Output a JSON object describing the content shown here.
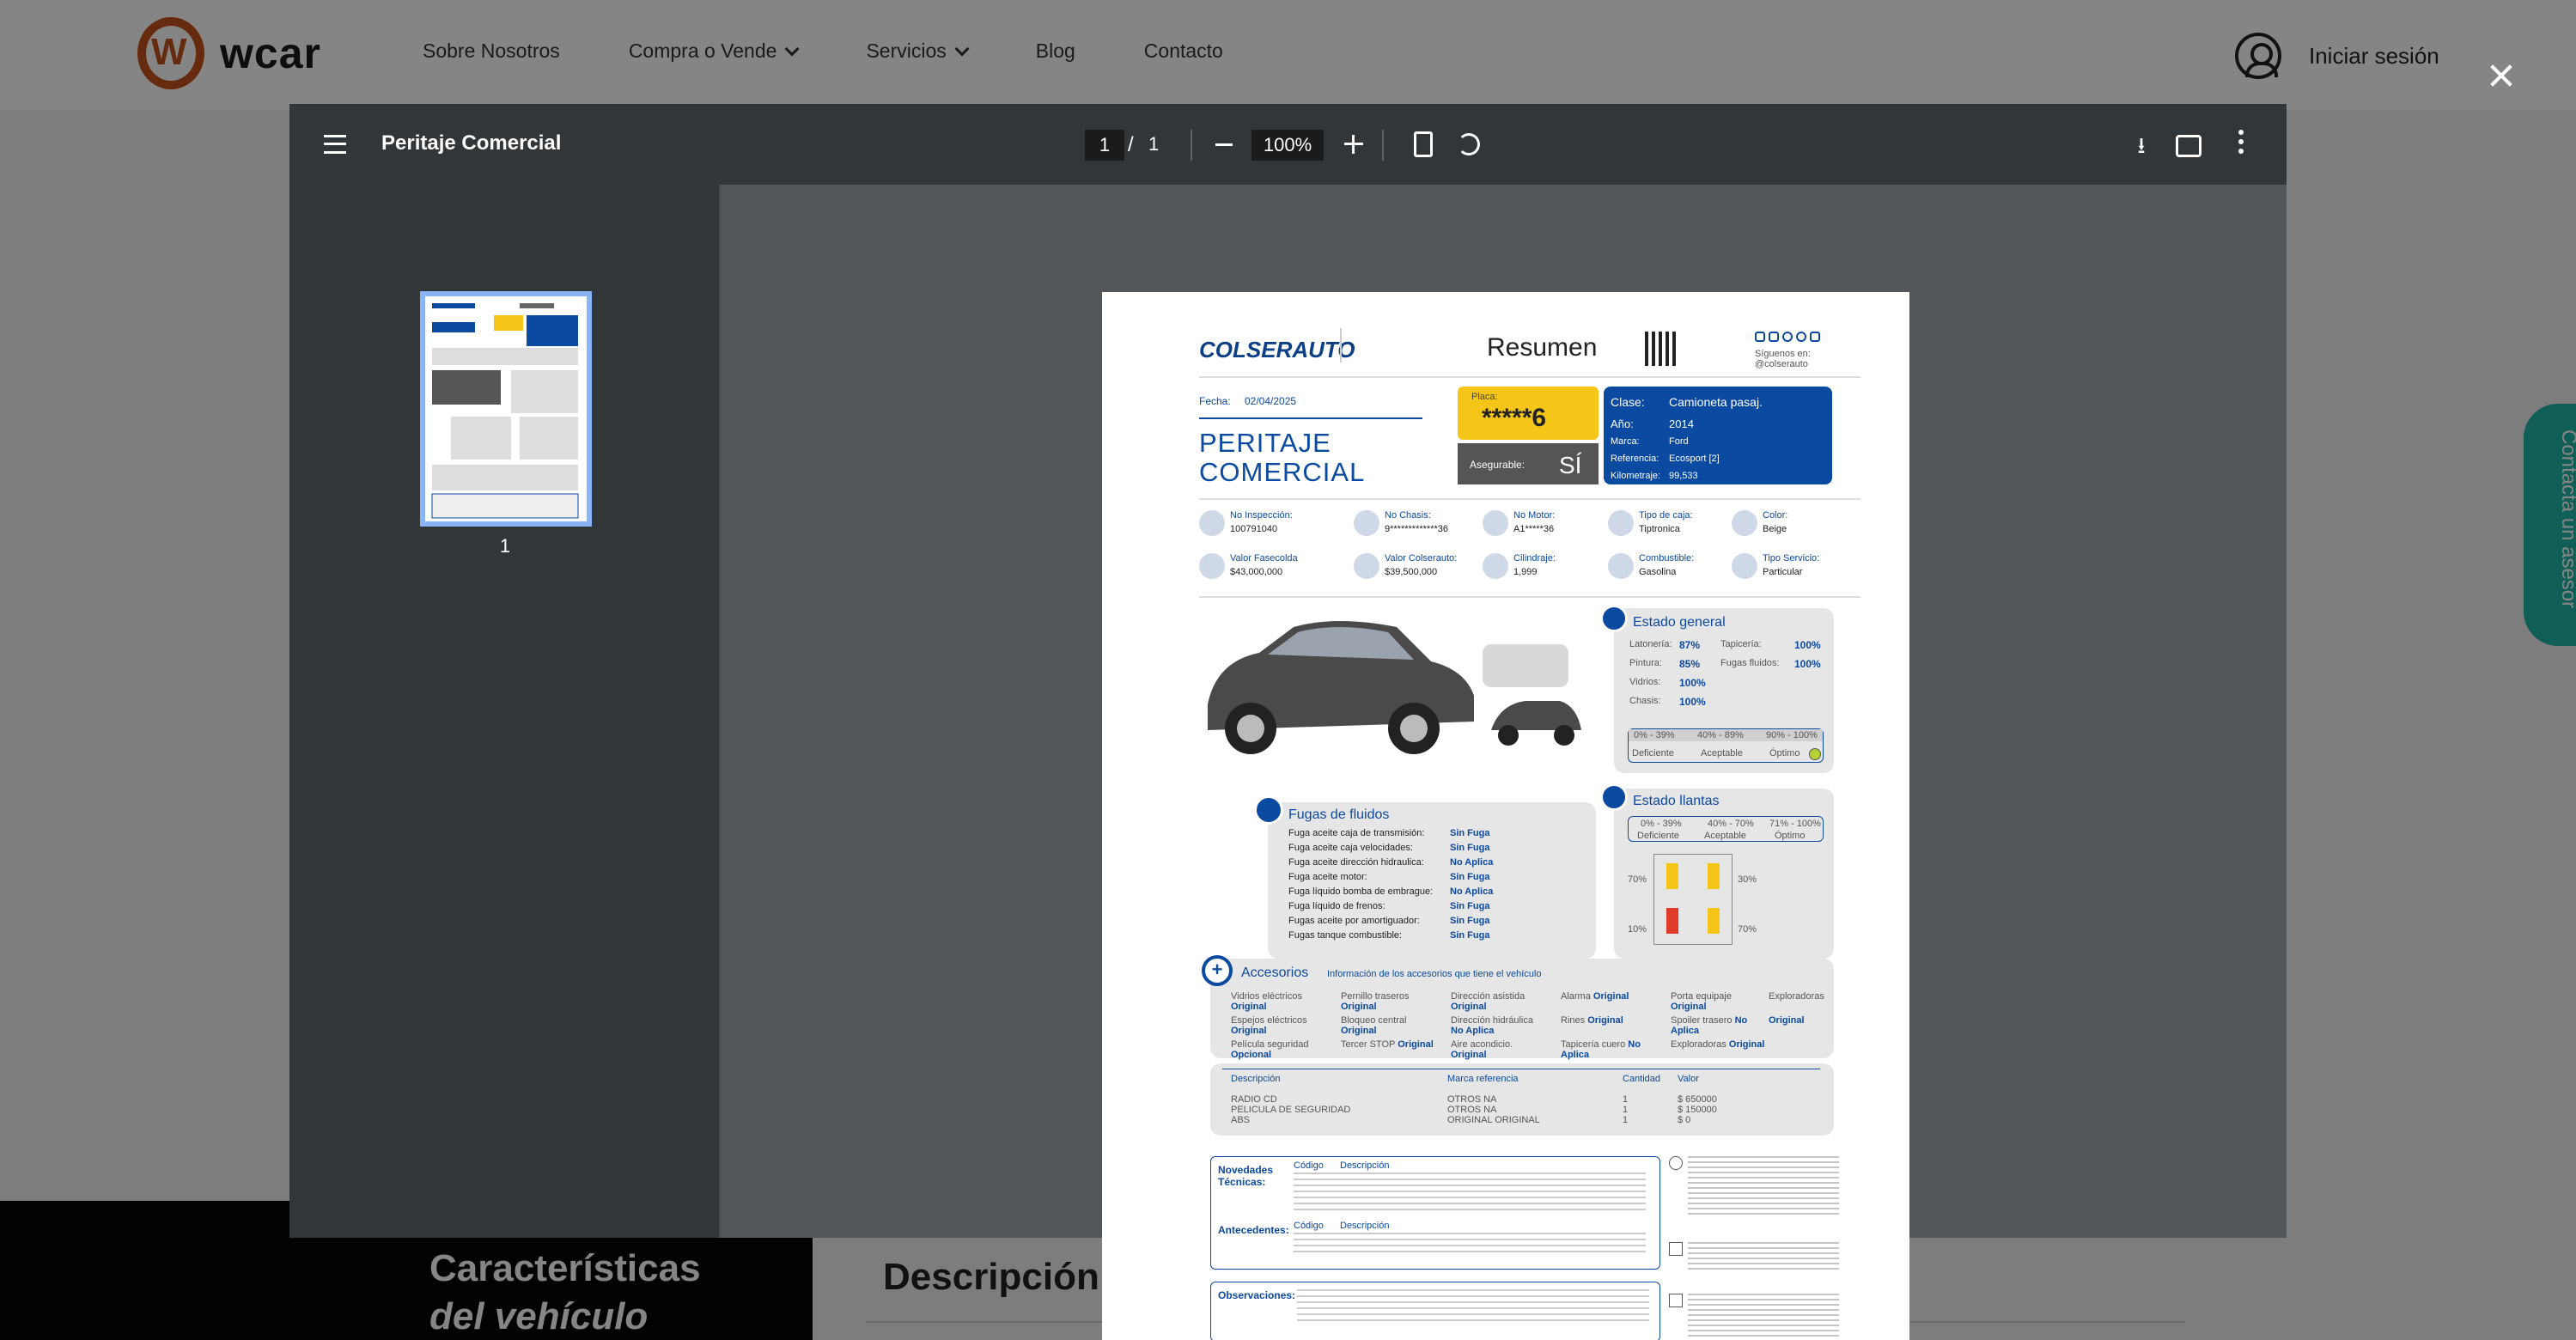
{
  "site": {
    "logo_text": "wcar",
    "nav": [
      "Sobre Nosotros",
      "Compra o Vende",
      "Servicios",
      "Blog",
      "Contacto"
    ],
    "login_label": "Iniciar sesión",
    "char_title_line1": "Características",
    "char_title_line2": "del vehículo",
    "desc_title": "Descripción",
    "side_tab": "Contacta un asesor"
  },
  "viewer": {
    "title": "Peritaje Comercial",
    "page_current": "1",
    "page_sep": "/",
    "page_total": "1",
    "zoom": "100%",
    "thumb_label": "1"
  },
  "report": {
    "brand": "COLSERAUTO",
    "summary": "Resumen",
    "follow": "Síguenos en: @colserauto",
    "date_label": "Fecha:",
    "date": "02/04/2025",
    "title_line1": "PERITAJE",
    "title_line2": "COMERCIAL",
    "plate_label": "Placa:",
    "plate": "*****6",
    "insurable_label": "Asegurable:",
    "insurable": "SÍ",
    "specs": [
      {
        "label": "Clase:",
        "value": "Camioneta pasaj."
      },
      {
        "label": "Año:",
        "value": "2014"
      },
      {
        "label": "Marca:",
        "value": "Ford"
      },
      {
        "label": "Referencia:",
        "value": "Ecosport [2]"
      },
      {
        "label": "Kilometraje:",
        "value": "99,533"
      }
    ],
    "info": [
      {
        "label": "No Inspección:",
        "value": "100791040"
      },
      {
        "label": "No Chasis:",
        "value": "9*************36"
      },
      {
        "label": "No Motor:",
        "value": "A1*****36"
      },
      {
        "label": "Tipo de caja:",
        "value": "Tiptronica"
      },
      {
        "label": "Color:",
        "value": "Beige"
      },
      {
        "label": "Valor Fasecolda",
        "value": "$43,000,000"
      },
      {
        "label": "Valor Colserauto:",
        "value": "$39,500,000"
      },
      {
        "label": "Cilindraje:",
        "value": "1,999"
      },
      {
        "label": "Combustible:",
        "value": "Gasolina"
      },
      {
        "label": "Tipo Servicio:",
        "value": "Particular"
      }
    ],
    "general_title": "Estado general",
    "general": [
      {
        "label": "Latonería:",
        "value": "87%"
      },
      {
        "label": "Tapicería:",
        "value": "100%"
      },
      {
        "label": "Pintura:",
        "value": "85%"
      },
      {
        "label": "Fugas fluidos:",
        "value": "100%"
      },
      {
        "label": "Vidrios:",
        "value": "100%"
      },
      {
        "label": "Chasis:",
        "value": "100%"
      }
    ],
    "scale_ranges": [
      "0% - 39%",
      "40% - 89%",
      "90% - 100%"
    ],
    "scale_labels": [
      "Deficiente",
      "Aceptable",
      "Óptimo"
    ],
    "tires_title": "Estado llantas",
    "tire_ranges": [
      "0% - 39%",
      "40% - 70%",
      "71% - 100%"
    ],
    "tire_values": [
      "70%",
      "30%",
      "10%",
      "70%"
    ],
    "leaks_title": "Fugas de fluidos",
    "leaks": [
      {
        "label": "Fuga aceite caja de transmisión:",
        "value": "Sin Fuga"
      },
      {
        "label": "Fuga aceite caja velocidades:",
        "value": "Sin Fuga"
      },
      {
        "label": "Fuga aceite dirección hidraulica:",
        "value": "No Aplica"
      },
      {
        "label": "Fuga aceite motor:",
        "value": "Sin Fuga"
      },
      {
        "label": "Fuga líquido bomba de embrague:",
        "value": "No Aplica"
      },
      {
        "label": "Fuga líquido de frenos:",
        "value": "Sin Fuga"
      },
      {
        "label": "Fugas aceite por amortiguador:",
        "value": "Sin Fuga"
      },
      {
        "label": "Fugas tanque combustible:",
        "value": "Sin Fuga"
      }
    ],
    "acc_title": "Accesorios",
    "acc_subtitle": "Información de los accesorios que tiene el vehículo",
    "accessories": [
      {
        "label": "Vidrios eléctricos",
        "value": "Original"
      },
      {
        "label": "Pernillo traseros",
        "value": "Original"
      },
      {
        "label": "Dirección asistida",
        "value": "Original"
      },
      {
        "label": "Alarma",
        "value": "Original"
      },
      {
        "label": "Porta equipaje",
        "value": "Original"
      },
      {
        "label": "Exploradoras",
        "value": ""
      },
      {
        "label": "Espejos eléctricos",
        "value": "Original"
      },
      {
        "label": "Bloqueo central",
        "value": "Original"
      },
      {
        "label": "Dirección hidráulica",
        "value": "No Aplica"
      },
      {
        "label": "Rines",
        "value": "Original"
      },
      {
        "label": "Spoiler trasero",
        "value": "No Aplica"
      },
      {
        "label": "",
        "value": "Original"
      },
      {
        "label": "Película seguridad",
        "value": "Opcional"
      },
      {
        "label": "Tercer STOP",
        "value": "Original"
      },
      {
        "label": "Aire acondicio.",
        "value": "Original"
      },
      {
        "label": "Tapicería cuero",
        "value": "No Aplica"
      },
      {
        "label": "Exploradoras",
        "value": "Original"
      }
    ],
    "table_headers": [
      "Descripción",
      "Marca referencia",
      "Cantidad",
      "Valor"
    ],
    "table_rows": [
      [
        "RADIO CD",
        "OTROS NA",
        "1",
        "$ 650000"
      ],
      [
        "PELICULA DE SEGURIDAD",
        "OTROS NA",
        "1",
        "$ 150000"
      ],
      [
        "ABS",
        "ORIGINAL ORIGINAL",
        "1",
        "$ 0"
      ]
    ],
    "novedades_title": "Novedades Técnicas:",
    "antecedentes_title": "Antecedentes:",
    "observaciones_title": "Observaciones:",
    "code_header": "Código",
    "desc_header": "Descripción"
  }
}
